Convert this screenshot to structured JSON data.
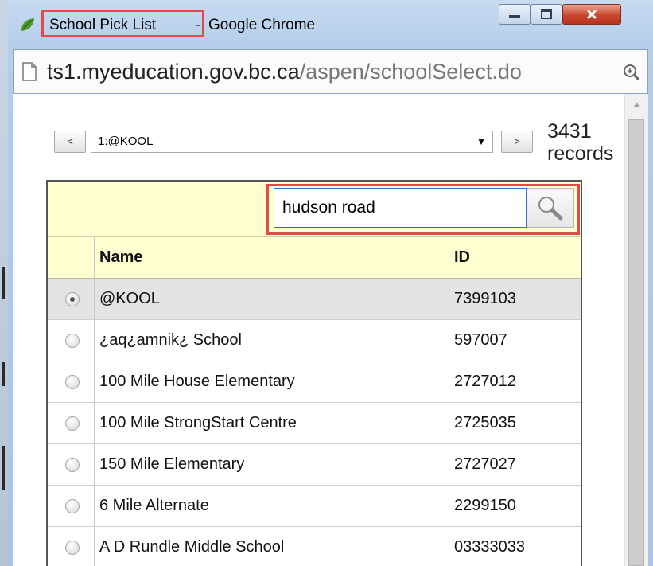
{
  "window": {
    "title_tab": "School Pick List",
    "title_sep": "-",
    "title_app": "Google Chrome"
  },
  "address": {
    "host": "ts1.myeducation.gov.bc.ca",
    "path": "/aspen/schoolSelect.do"
  },
  "pager": {
    "prev_label": "<",
    "next_label": ">",
    "selected_school": "1:@KOOL",
    "records_count": "3431",
    "records_label": "records"
  },
  "filter": {
    "search_value": "hudson road"
  },
  "grid": {
    "columns": [
      "Name",
      "ID"
    ],
    "rows": [
      {
        "name": "@KOOL",
        "id": "7399103",
        "selected": true
      },
      {
        "name": "¿aq¿amnik¿ School",
        "id": "597007",
        "selected": false
      },
      {
        "name": "100 Mile House Elementary",
        "id": "2727012",
        "selected": false
      },
      {
        "name": "100 Mile StrongStart Centre",
        "id": "2725035",
        "selected": false
      },
      {
        "name": "150 Mile Elementary",
        "id": "2727027",
        "selected": false
      },
      {
        "name": "6 Mile Alternate",
        "id": "2299150",
        "selected": false
      },
      {
        "name": "A D Rundle Middle School",
        "id": "03333033",
        "selected": false
      }
    ]
  },
  "colors": {
    "highlight_box": "#e34a4a",
    "grid_header_bg": "#ffffd2",
    "selected_row_bg": "#e3e3e3"
  },
  "icons": {
    "app": "chrome-leaf-icon",
    "page": "page-icon",
    "zoom": "zoom-icon",
    "search": "magnifier-icon"
  }
}
